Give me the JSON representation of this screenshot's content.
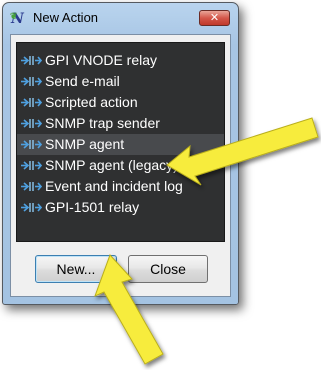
{
  "window": {
    "title": "New Action",
    "app_icon_glyph": "N",
    "close_glyph": "✕",
    "accent_color": "#a7c5e4"
  },
  "actions_list": {
    "selected_index": 4,
    "items": [
      {
        "label": "GPI VNODE relay",
        "icon": "action-plugin-icon"
      },
      {
        "label": "Send e-mail",
        "icon": "action-plugin-icon"
      },
      {
        "label": "Scripted action",
        "icon": "action-plugin-icon"
      },
      {
        "label": "SNMP trap sender",
        "icon": "action-plugin-icon"
      },
      {
        "label": "SNMP agent",
        "icon": "action-plugin-icon"
      },
      {
        "label": "SNMP agent (legacy)",
        "icon": "action-plugin-icon"
      },
      {
        "label": "Event and incident log",
        "icon": "action-plugin-icon"
      },
      {
        "label": "GPI-1501 relay",
        "icon": "action-plugin-icon"
      }
    ]
  },
  "buttons": {
    "new_label": "New...",
    "close_label": "Close"
  },
  "annotation": {
    "arrow_color": "#f7ec3c"
  }
}
